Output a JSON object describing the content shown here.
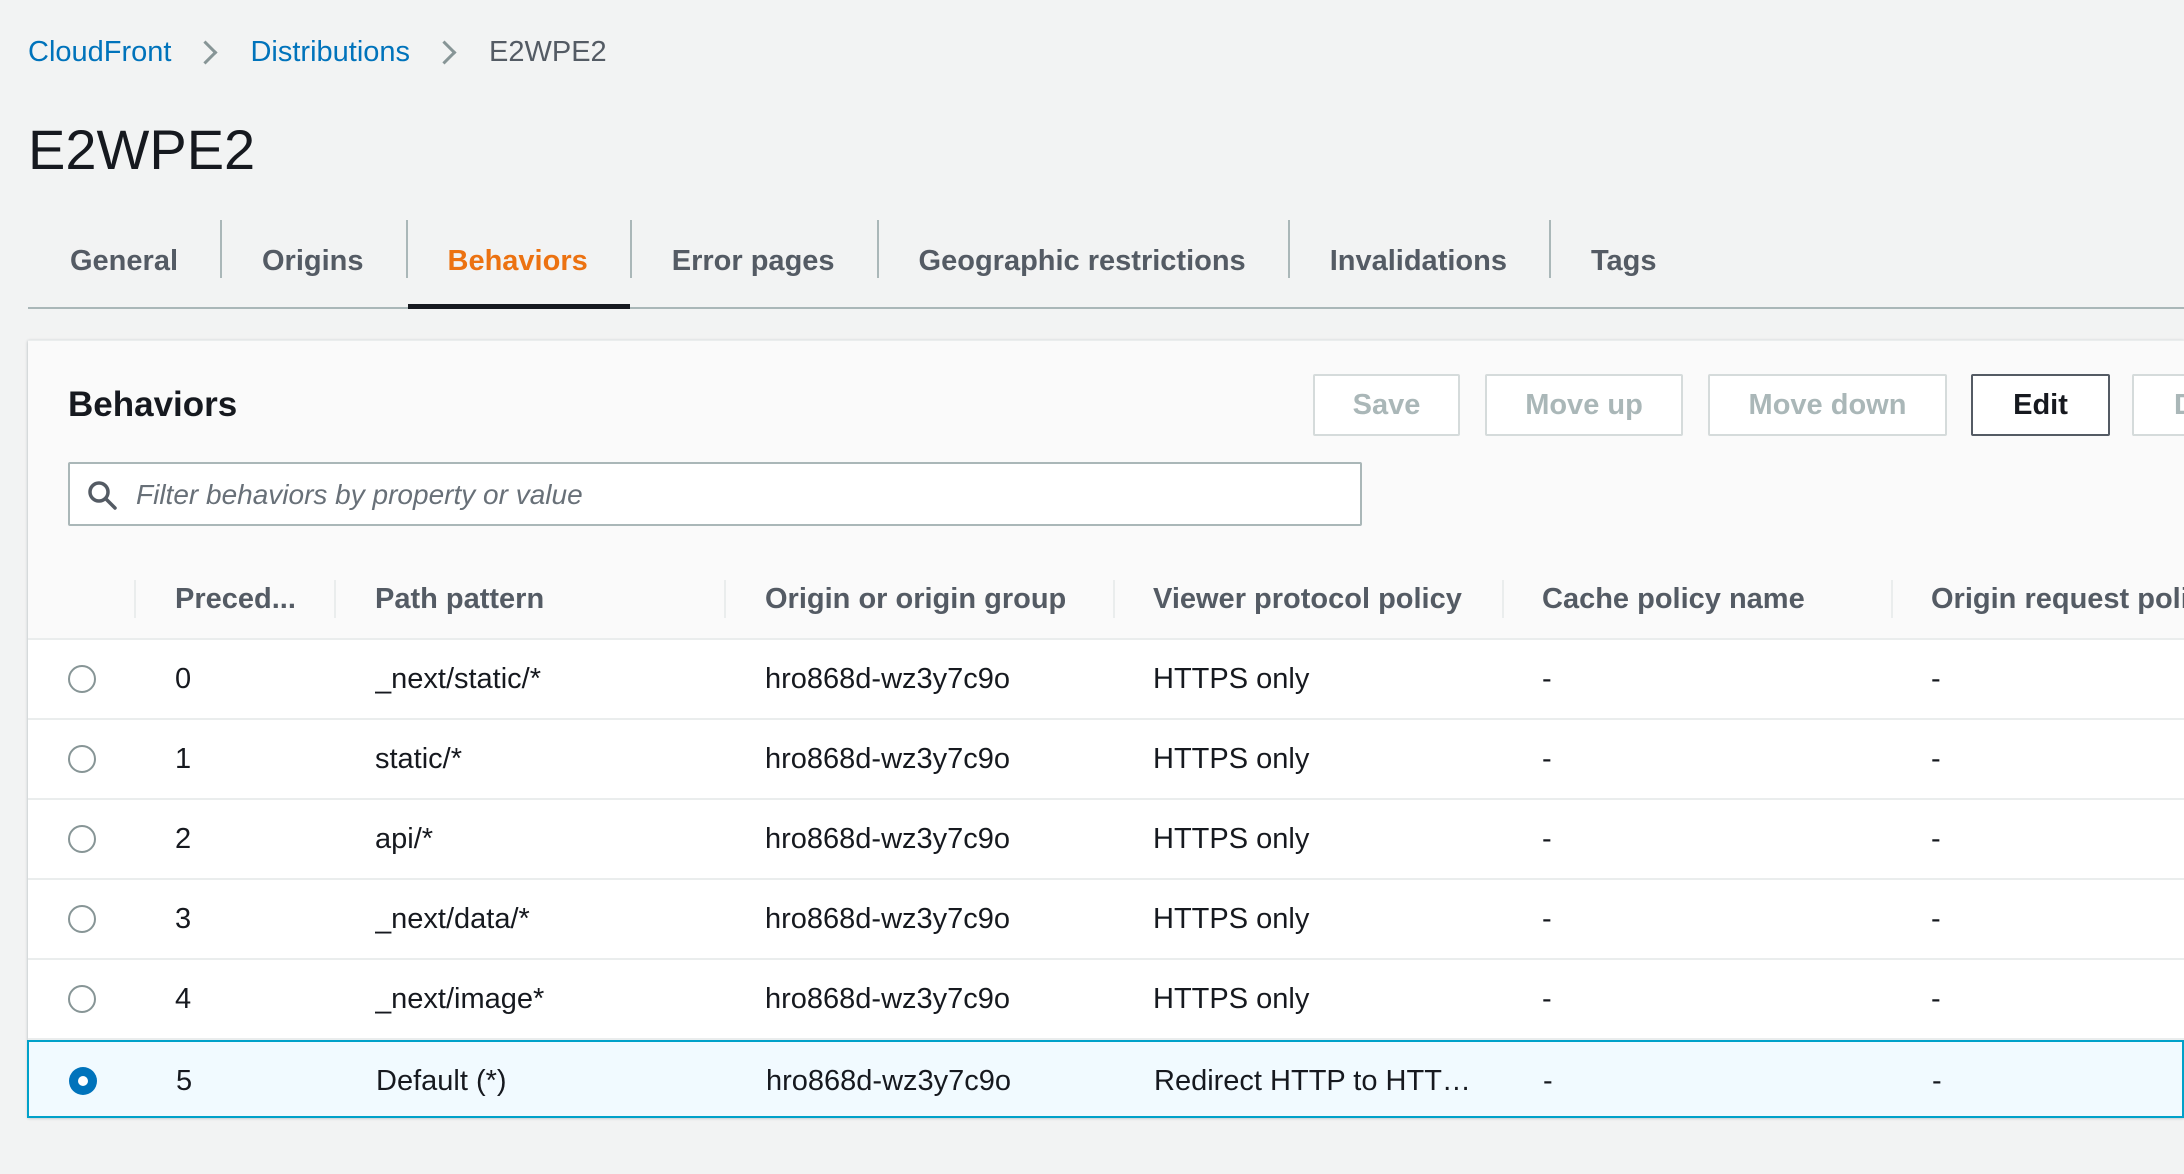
{
  "breadcrumb": {
    "root": "CloudFront",
    "section": "Distributions",
    "current": "E2WPE2"
  },
  "page": {
    "title": "E2WPE2"
  },
  "tabs": [
    {
      "label": "General"
    },
    {
      "label": "Origins"
    },
    {
      "label": "Behaviors"
    },
    {
      "label": "Error pages"
    },
    {
      "label": "Geographic restrictions"
    },
    {
      "label": "Invalidations"
    },
    {
      "label": "Tags"
    }
  ],
  "panel": {
    "title": "Behaviors",
    "buttons": {
      "save": "Save",
      "move_up": "Move up",
      "move_down": "Move down",
      "edit": "Edit",
      "delete": "D"
    },
    "search": {
      "placeholder": "Filter behaviors by property or value",
      "value": ""
    }
  },
  "table": {
    "columns": {
      "precedence": "Preced...",
      "path": "Path pattern",
      "origin": "Origin or origin group",
      "viewer": "Viewer protocol policy",
      "cache": "Cache policy name",
      "origin_request": "Origin request polic"
    },
    "rows": [
      {
        "precedence": "0",
        "path": "_next/static/*",
        "origin": "hro868d-wz3y7c9o",
        "viewer": "HTTPS only",
        "cache": "-",
        "origin_request": "-"
      },
      {
        "precedence": "1",
        "path": "static/*",
        "origin": "hro868d-wz3y7c9o",
        "viewer": "HTTPS only",
        "cache": "-",
        "origin_request": "-"
      },
      {
        "precedence": "2",
        "path": "api/*",
        "origin": "hro868d-wz3y7c9o",
        "viewer": "HTTPS only",
        "cache": "-",
        "origin_request": "-"
      },
      {
        "precedence": "3",
        "path": "_next/data/*",
        "origin": "hro868d-wz3y7c9o",
        "viewer": "HTTPS only",
        "cache": "-",
        "origin_request": "-"
      },
      {
        "precedence": "4",
        "path": "_next/image*",
        "origin": "hro868d-wz3y7c9o",
        "viewer": "HTTPS only",
        "cache": "-",
        "origin_request": "-"
      },
      {
        "precedence": "5",
        "path": "Default (*)",
        "origin": "hro868d-wz3y7c9o",
        "viewer": "Redirect HTTP to HTT…",
        "cache": "-",
        "origin_request": "-"
      }
    ]
  }
}
